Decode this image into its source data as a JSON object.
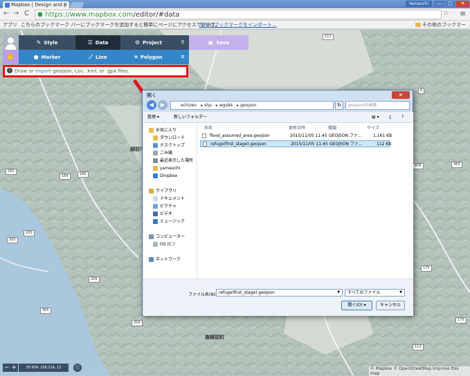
{
  "browser": {
    "tab_title": "Mapbox | Design and p",
    "tab_close": "×",
    "user_badge": "Yamauchi",
    "win_min": "—",
    "win_max": "□",
    "win_close": "✕",
    "url_host": "https://www.mapbox.com",
    "url_path": "/editor/#data",
    "back": "←",
    "forward": "→",
    "reload": "C",
    "star": "☆",
    "menu": "≡",
    "bookmarks": {
      "apps_label": "アプリ",
      "message": "こちらのブックマーク バーにブックマークを追加すると簡単にページにアクセスできます。",
      "import_link": "今すぐブックマークをインポート...",
      "other": "その他のブックマーク"
    }
  },
  "toolbar": {
    "style_label": "Style",
    "data_label": "Data",
    "project_label": "Project",
    "search_icon": "⚲",
    "save_label": "Save",
    "marker_label": "Marker",
    "line_label": "Line",
    "polygon_label": "Polygon",
    "list_icon": "≡"
  },
  "import_bar": {
    "prefix": "Draw or ",
    "link": "import",
    "suffix": " geojson, csv, .kml, or .gpx files."
  },
  "map": {
    "places": [
      "越前市",
      "南越前町"
    ],
    "route_shields": [
      "113",
      "184",
      "265",
      "186",
      "305",
      "476",
      "365",
      "206",
      "205",
      "204",
      "305",
      "175",
      "175",
      "8",
      "113"
    ]
  },
  "dialog": {
    "title": "開く",
    "close": "✕",
    "path": [
      "echizen",
      "shp",
      "wgs84",
      "geojson"
    ],
    "search_placeholder": "geojsonの検索",
    "organize": "整理 ▾",
    "new_folder": "新しいフォルダー",
    "tree": [
      {
        "label": "お気に入り",
        "group": true
      },
      {
        "label": "ダウンロード",
        "group": false
      },
      {
        "label": "デスクトップ",
        "group": false
      },
      {
        "label": "ごみ箱",
        "group": false
      },
      {
        "label": "最近表示した場所",
        "group": false
      },
      {
        "label": "yamauchi",
        "group": false
      },
      {
        "label": "Dropbox",
        "group": false
      },
      {
        "label": "ライブラリ",
        "group": true
      },
      {
        "label": "ドキュメント",
        "group": false
      },
      {
        "label": "ピクチャ",
        "group": false
      },
      {
        "label": "ビデオ",
        "group": false
      },
      {
        "label": "ミュージック",
        "group": false
      },
      {
        "label": "コンピューター",
        "group": true
      },
      {
        "label": "OS (C:)",
        "group": false
      },
      {
        "label": "ネットワーク",
        "group": true
      }
    ],
    "columns": {
      "name": "名前",
      "date": "更新日時",
      "type": "種類",
      "size": "サイズ"
    },
    "files": [
      {
        "name": "flood_assumed_area.geojson",
        "date": "2015/11/05 11:45",
        "type": "GEOJSON ファ...",
        "size": "1,161 KB",
        "selected": false
      },
      {
        "name": "refuge(first_stage).geojson",
        "date": "2015/11/05 11:45",
        "type": "GEOJSON ファ...",
        "size": "112 KB",
        "selected": true
      }
    ],
    "filename_label": "ファイル名(N):",
    "filename_value": "refuge(first_stage).geojson",
    "filetype": "すべてのファイル",
    "open_label": "開く(O)",
    "cancel_label": "キャンセル"
  },
  "footer": {
    "zoom": "− +",
    "coords": "35.934, 136.214, 12",
    "info": "ⓘ",
    "attribution": "© Mapbox © OpenStreetMap Improve this map"
  },
  "colors": {
    "toolbar_dark": "#3a4e63",
    "toolbar_active": "#1f2d3b",
    "draw_blue": "#3486c9",
    "save_purple": "#c3b1ec",
    "highlight_red": "#e3131b"
  }
}
